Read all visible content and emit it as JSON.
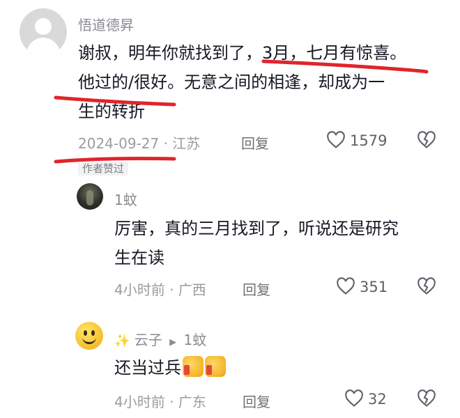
{
  "comment": {
    "username": "悟道德昇",
    "text_line1": "谢叔，明年你就找到了，3月，七月有惊喜。",
    "text_line2": "他过的/很好。无意之间的相逢，却成为一",
    "text_line3": "生的转折",
    "date": "2024-09-27 · 江苏",
    "reply_label": "回复",
    "like_count": "1579",
    "badge": "作者赞过"
  },
  "replies": [
    {
      "username": "1蚊",
      "text_line1": "厉害，真的三月找到了，听说还是研究",
      "text_line2": "生在读",
      "meta": "4小时前 · 广西",
      "reply_label": "回复",
      "like_count": "351"
    },
    {
      "username": "云子",
      "reply_to": "1蚊",
      "text": "还当过兵",
      "meta": "4小时前 · 广东",
      "reply_label": "回复",
      "like_count": "32"
    }
  ],
  "colors": {
    "annotation_red": "#e0252b",
    "meta_gray": "#9a9ba1",
    "text_dark": "#161823"
  },
  "icons": [
    "heart-icon",
    "dislike-heart-icon",
    "default-avatar-icon",
    "thumbs-up-emoji"
  ]
}
